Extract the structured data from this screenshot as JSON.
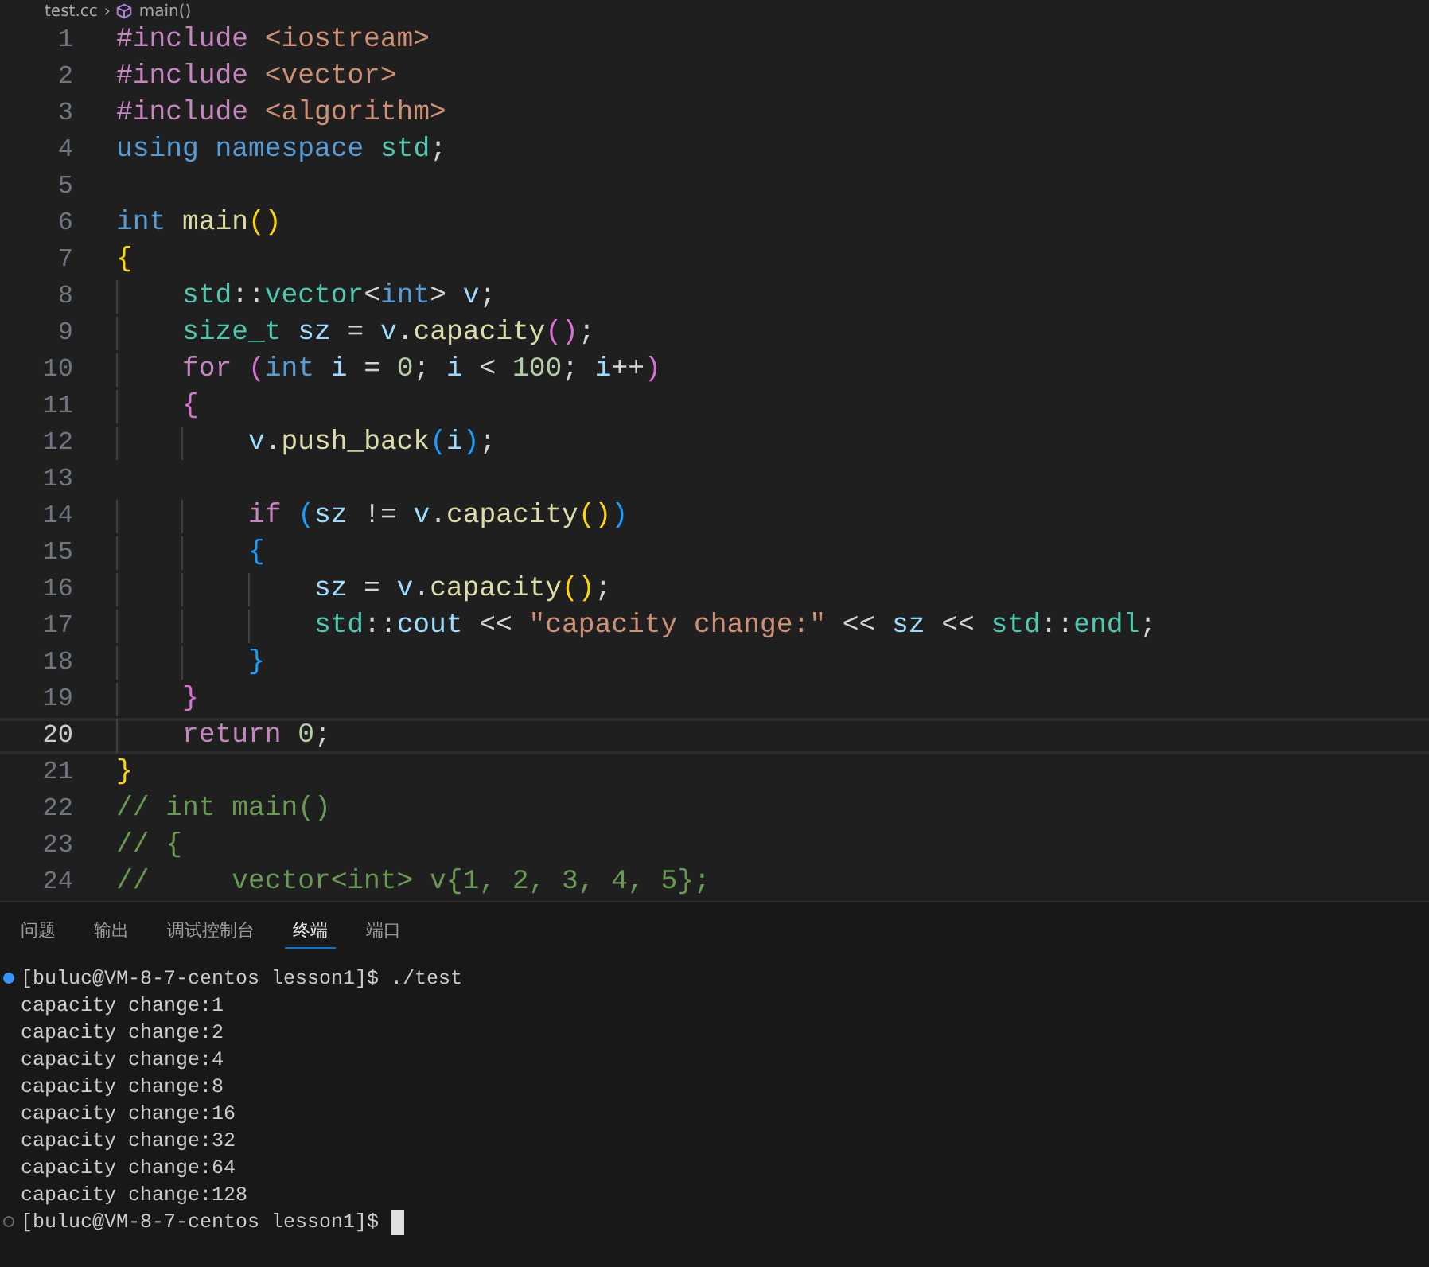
{
  "breadcrumb": {
    "file": "test.cc",
    "separator": "›",
    "symbol": "main()"
  },
  "editor": {
    "lines": [
      {
        "number": "1",
        "current": false,
        "tokens": [
          {
            "kind": "kw",
            "text": "#include"
          },
          {
            "kind": "str",
            "text": " <iostream>"
          }
        ]
      },
      {
        "number": "2",
        "current": false,
        "tokens": [
          {
            "kind": "kw",
            "text": "#include"
          },
          {
            "kind": "str",
            "text": " <vector>"
          }
        ]
      },
      {
        "number": "3",
        "current": false,
        "tokens": [
          {
            "kind": "kw",
            "text": "#include"
          },
          {
            "kind": "str",
            "text": " <algorithm>"
          }
        ]
      },
      {
        "number": "4",
        "current": false,
        "tokens": [
          {
            "kind": "type",
            "text": "using"
          },
          {
            "kind": "type",
            "text": " namespace"
          },
          {
            "kind": "ns",
            "text": " std"
          },
          {
            "kind": "p",
            "text": ";"
          }
        ]
      },
      {
        "number": "5",
        "current": false
      },
      {
        "number": "6",
        "current": false,
        "tokens": [
          {
            "kind": "type",
            "text": "int"
          },
          {
            "kind": "fn",
            "text": " main"
          },
          {
            "kind": "b1",
            "text": "()"
          }
        ]
      },
      {
        "number": "7",
        "current": false,
        "tokens": [
          {
            "kind": "b1",
            "text": "{"
          }
        ]
      },
      {
        "number": "8",
        "current": false,
        "tokens": [
          {
            "kind": "ns",
            "text": "    std"
          },
          {
            "kind": "p",
            "text": "::"
          },
          {
            "kind": "ns",
            "text": "vector"
          },
          {
            "kind": "p",
            "text": "<"
          },
          {
            "kind": "type",
            "text": "int"
          },
          {
            "kind": "p",
            "text": ">"
          },
          {
            "kind": "var",
            "text": " v"
          },
          {
            "kind": "p",
            "text": ";"
          }
        ]
      },
      {
        "number": "9",
        "current": false,
        "tokens": [
          {
            "kind": "ns",
            "text": "    size_t"
          },
          {
            "kind": "var",
            "text": " sz"
          },
          {
            "kind": "p",
            "text": " ="
          },
          {
            "kind": "var",
            "text": " v"
          },
          {
            "kind": "p",
            "text": "."
          },
          {
            "kind": "fn",
            "text": "capacity"
          },
          {
            "kind": "b2",
            "text": "()"
          },
          {
            "kind": "p",
            "text": ";"
          }
        ]
      },
      {
        "number": "10",
        "current": false,
        "tokens": [
          {
            "kind": "kw",
            "text": "    for"
          },
          {
            "kind": "b2",
            "text": " ("
          },
          {
            "kind": "type",
            "text": "int"
          },
          {
            "kind": "var",
            "text": " i"
          },
          {
            "kind": "p",
            "text": " ="
          },
          {
            "kind": "num",
            "text": " 0"
          },
          {
            "kind": "p",
            "text": ";"
          },
          {
            "kind": "var",
            "text": " i"
          },
          {
            "kind": "p",
            "text": " <"
          },
          {
            "kind": "num",
            "text": " 100"
          },
          {
            "kind": "p",
            "text": ";"
          },
          {
            "kind": "var",
            "text": " i"
          },
          {
            "kind": "p",
            "text": "++"
          },
          {
            "kind": "b2",
            "text": ")"
          }
        ]
      },
      {
        "number": "11",
        "current": false,
        "tokens": [
          {
            "kind": "b2",
            "text": "    {"
          }
        ]
      },
      {
        "number": "12",
        "current": false,
        "tokens": [
          {
            "kind": "var",
            "text": "        v"
          },
          {
            "kind": "p",
            "text": "."
          },
          {
            "kind": "fn",
            "text": "push_back"
          },
          {
            "kind": "b3",
            "text": "("
          },
          {
            "kind": "var",
            "text": "i"
          },
          {
            "kind": "b3",
            "text": ")"
          },
          {
            "kind": "p",
            "text": ";"
          }
        ]
      },
      {
        "number": "13",
        "current": false
      },
      {
        "number": "14",
        "current": false,
        "tokens": [
          {
            "kind": "kw",
            "text": "        if"
          },
          {
            "kind": "b3",
            "text": " ("
          },
          {
            "kind": "var",
            "text": "sz"
          },
          {
            "kind": "p",
            "text": " !="
          },
          {
            "kind": "var",
            "text": " v"
          },
          {
            "kind": "p",
            "text": "."
          },
          {
            "kind": "fn",
            "text": "capacity"
          },
          {
            "kind": "b1",
            "text": "()"
          },
          {
            "kind": "b3",
            "text": ")"
          }
        ]
      },
      {
        "number": "15",
        "current": false,
        "tokens": [
          {
            "kind": "b3",
            "text": "        {"
          }
        ]
      },
      {
        "number": "16",
        "current": false,
        "tokens": [
          {
            "kind": "var",
            "text": "            sz"
          },
          {
            "kind": "p",
            "text": " ="
          },
          {
            "kind": "var",
            "text": " v"
          },
          {
            "kind": "p",
            "text": "."
          },
          {
            "kind": "fn",
            "text": "capacity"
          },
          {
            "kind": "b1",
            "text": "()"
          },
          {
            "kind": "p",
            "text": ";"
          }
        ]
      },
      {
        "number": "17",
        "current": false,
        "tokens": [
          {
            "kind": "ns",
            "text": "            std"
          },
          {
            "kind": "p",
            "text": "::"
          },
          {
            "kind": "var",
            "text": "cout"
          },
          {
            "kind": "p",
            "text": " <<"
          },
          {
            "kind": "str",
            "text": " \"capacity change:\""
          },
          {
            "kind": "p",
            "text": " <<"
          },
          {
            "kind": "var",
            "text": " sz"
          },
          {
            "kind": "p",
            "text": " <<"
          },
          {
            "kind": "ns",
            "text": " std"
          },
          {
            "kind": "p",
            "text": "::"
          },
          {
            "kind": "ns",
            "text": "endl"
          },
          {
            "kind": "p",
            "text": ";"
          }
        ]
      },
      {
        "number": "18",
        "current": false,
        "tokens": [
          {
            "kind": "b3",
            "text": "        }"
          }
        ]
      },
      {
        "number": "19",
        "current": false,
        "tokens": [
          {
            "kind": "b2",
            "text": "    }"
          }
        ]
      },
      {
        "number": "20",
        "current": true,
        "tokens": [
          {
            "kind": "kw",
            "text": "    return"
          },
          {
            "kind": "num",
            "text": " 0"
          },
          {
            "kind": "p",
            "text": ";"
          }
        ]
      },
      {
        "number": "21",
        "current": false,
        "tokens": [
          {
            "kind": "b1",
            "text": "}"
          }
        ]
      },
      {
        "number": "22",
        "current": false,
        "tokens": [
          {
            "kind": "cm",
            "text": "// int main()"
          }
        ]
      },
      {
        "number": "23",
        "current": false,
        "tokens": [
          {
            "kind": "cm",
            "text": "// {"
          }
        ]
      },
      {
        "number": "24",
        "current": false,
        "tokens": [
          {
            "kind": "cm",
            "text": "//     vector<int> v{1, 2, 3, 4, 5};"
          }
        ]
      }
    ]
  },
  "panel": {
    "tabs": [
      {
        "label": "问题",
        "selected": false
      },
      {
        "label": "输出",
        "selected": false
      },
      {
        "label": "调试控制台",
        "selected": false
      },
      {
        "label": "终端",
        "selected": true
      },
      {
        "label": "端口",
        "selected": false
      }
    ],
    "terminal": [
      {
        "kind": "command",
        "text": "[buluc@VM-8-7-centos lesson1]$ ./test"
      },
      {
        "kind": "output",
        "text": "capacity change:1"
      },
      {
        "kind": "output",
        "text": "capacity change:2"
      },
      {
        "kind": "output",
        "text": "capacity change:4"
      },
      {
        "kind": "output",
        "text": "capacity change:8"
      },
      {
        "kind": "output",
        "text": "capacity change:16"
      },
      {
        "kind": "output",
        "text": "capacity change:32"
      },
      {
        "kind": "output",
        "text": "capacity change:64"
      },
      {
        "kind": "output",
        "text": "capacity change:128"
      },
      {
        "kind": "prompt",
        "text": "[buluc@VM-8-7-centos lesson1]$",
        "cursor": true
      }
    ]
  }
}
